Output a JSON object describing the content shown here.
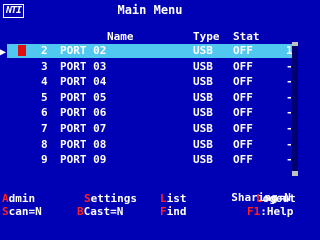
{
  "header": {
    "logo": "NTI",
    "title": "Main Menu"
  },
  "columns": {
    "name": "Name",
    "type": "Type",
    "status": "Stat"
  },
  "rows": [
    {
      "num": "2",
      "name": "PORT 02",
      "type": "USB",
      "status": "OFF",
      "extra": "1"
    },
    {
      "num": "3",
      "name": "PORT 03",
      "type": "USB",
      "status": "OFF",
      "extra": "-"
    },
    {
      "num": "4",
      "name": "PORT 04",
      "type": "USB",
      "status": "OFF",
      "extra": "-"
    },
    {
      "num": "5",
      "name": "PORT 05",
      "type": "USB",
      "status": "OFF",
      "extra": "-"
    },
    {
      "num": "6",
      "name": "PORT 06",
      "type": "USB",
      "status": "OFF",
      "extra": "-"
    },
    {
      "num": "7",
      "name": "PORT 07",
      "type": "USB",
      "status": "OFF",
      "extra": "-"
    },
    {
      "num": "8",
      "name": "PORT 08",
      "type": "USB",
      "status": "OFF",
      "extra": "-"
    },
    {
      "num": "9",
      "name": "PORT 09",
      "type": "USB",
      "status": "OFF",
      "extra": "-"
    }
  ],
  "selected_row_index": 0,
  "footer": {
    "sharing": {
      "label": "Sharing=",
      "value": "N"
    },
    "admin": {
      "key": "A",
      "rest": "dmin"
    },
    "settings": {
      "key": "S",
      "rest": "ettings"
    },
    "list": {
      "key": "L",
      "rest": "ist"
    },
    "logout": {
      "key": "L",
      "rest": "ogout"
    },
    "scan": {
      "key": "S",
      "rest": "can=N"
    },
    "bcast": {
      "key": "B",
      "rest": "Cast=N"
    },
    "find": {
      "key": "F",
      "rest": "ind"
    },
    "help": {
      "key": "F1",
      "rest": ":Help"
    }
  },
  "colors": {
    "background": "#0000b4",
    "highlight": "#50c8f0",
    "hotkey": "#ff2020",
    "text": "#ffffff"
  }
}
